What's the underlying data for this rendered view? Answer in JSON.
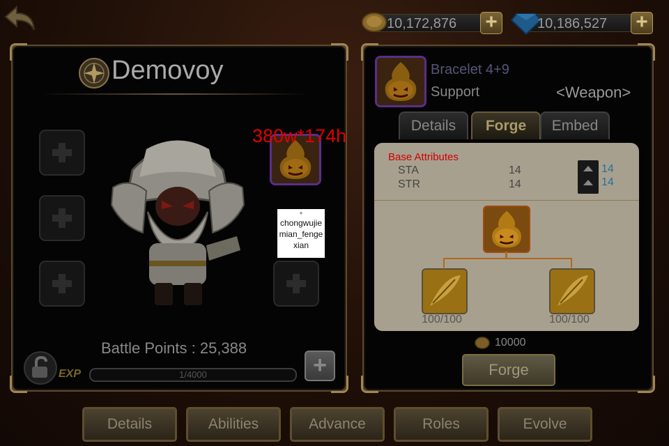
{
  "top_bar": {
    "gold": "10,172,876",
    "gems": "10,186,527"
  },
  "hero": {
    "name": "Demovoy",
    "battle_points": "Battle Points : 25,388",
    "exp_label": "EXP",
    "exp_text": "1/4000",
    "exp_progress": 0.00025
  },
  "overlay": {
    "annotation": "380w*174h",
    "placeholder_text": "chongwujiemian_fengexian"
  },
  "equipment": {
    "name": "Bracelet 4+9",
    "role": "Support",
    "slot": "<Weapon>",
    "tabs": [
      "Details",
      "Forge",
      "Embed"
    ],
    "active_tab": "Forge"
  },
  "forge": {
    "base_attributes_label": "Base Attributes",
    "stats": [
      {
        "name": "STA",
        "value": "14",
        "upgrade": "14"
      },
      {
        "name": "STR",
        "value": "14",
        "upgrade": "14"
      }
    ],
    "materials": [
      {
        "count": "100/100"
      },
      {
        "count": "100/100"
      }
    ],
    "cost": "10000",
    "button": "Forge"
  },
  "bottom_nav": [
    "Details",
    "Abilities",
    "Advance",
    "Roles",
    "Evolve"
  ],
  "colors": {
    "accent_gold": "#a08656",
    "stat_upgrade": "#2a6f95",
    "annotation_red": "#e00000",
    "equip_border": "#5a2e8a"
  }
}
